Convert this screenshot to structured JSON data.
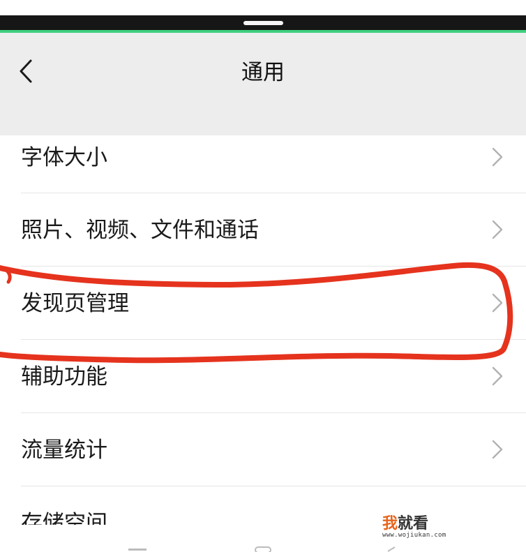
{
  "header": {
    "title": "通用",
    "back_icon": "chevron-left-icon"
  },
  "settings_items": [
    {
      "label": "字体大小"
    },
    {
      "label": "照片、视频、文件和通话"
    },
    {
      "label": "发现页管理"
    },
    {
      "label": "辅助功能"
    },
    {
      "label": "流量统计"
    },
    {
      "label": "存储空间"
    }
  ],
  "watermark": {
    "brand_a": "我",
    "brand_b": "就看",
    "url": "www.wojiukan.com"
  },
  "colors": {
    "accent_green": "#3fcf7f",
    "nav_bg": "#ededed",
    "annotation_red": "#e5331e"
  }
}
